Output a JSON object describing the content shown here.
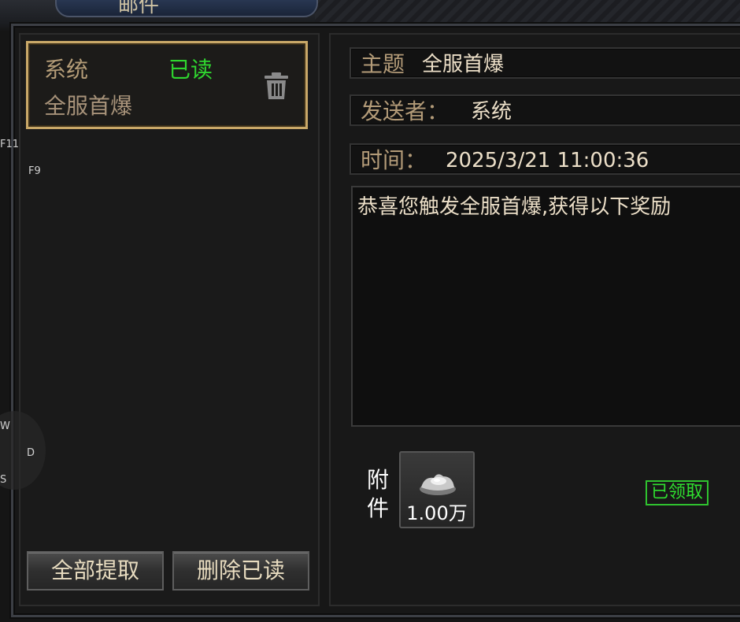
{
  "window": {
    "title": "邮件"
  },
  "hotkeys": {
    "f11": "F11",
    "f9": "F9",
    "w": "W",
    "d": "D",
    "s": "S"
  },
  "mail_list": {
    "items": [
      {
        "sender": "系统",
        "status": "已读",
        "subject": "全服首爆"
      }
    ]
  },
  "buttons": {
    "claim_all": "全部提取",
    "delete_read": "删除已读"
  },
  "detail": {
    "subject_label": "主题",
    "subject_value": "全服首爆",
    "sender_label": "发送者：",
    "sender_value": "系统",
    "time_label": "时间：",
    "time_value": "2025/3/21 11:00:36",
    "body": "恭喜您触发全服首爆,获得以下奖励"
  },
  "attachment": {
    "label_line1": "附",
    "label_line2": "件",
    "item_icon": "silver-ingot-icon",
    "item_count": "1.00万",
    "claim_status": "已领取"
  },
  "colors": {
    "read_status": "#2fd62f",
    "selected_border": "#c9a868",
    "claimed": "#2fe02f"
  }
}
